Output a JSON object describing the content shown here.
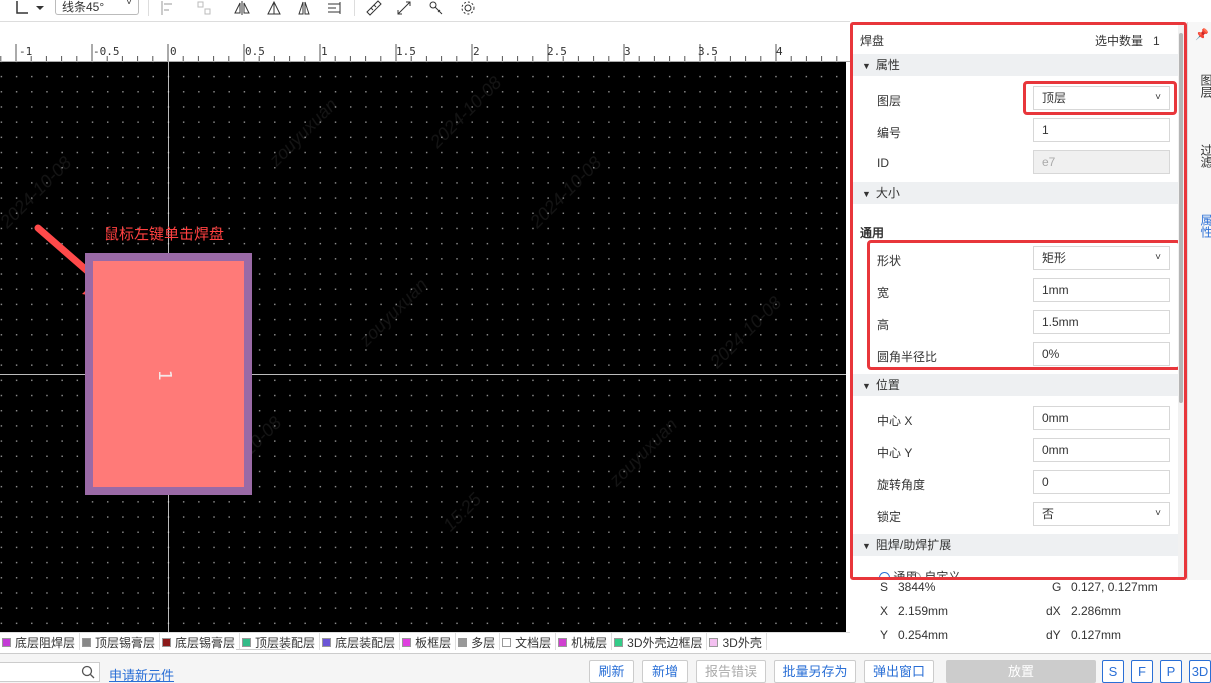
{
  "toolbar": {
    "line_mode": "线条45°"
  },
  "ruler": {
    "labels": [
      "-1",
      "-0.5",
      "0",
      "0.5",
      "1",
      "1.5",
      "2",
      "2.5",
      "3",
      "3.5",
      "4"
    ]
  },
  "canvas": {
    "annotation": "鼠标左键单击焊盘",
    "pad_number": "1",
    "watermarks": [
      "zouyuxuan",
      "2024-10-08",
      "15:25"
    ]
  },
  "layers": [
    {
      "name": "底层阻焊层",
      "color": "#c43bd6"
    },
    {
      "name": "顶层锡膏层",
      "color": "#888888"
    },
    {
      "name": "底层锡膏层",
      "color": "#8b1a1a"
    },
    {
      "name": "顶层装配层",
      "color": "#33bb88"
    },
    {
      "name": "底层装配层",
      "color": "#6b55d6"
    },
    {
      "name": "板框层",
      "color": "#e040e0"
    },
    {
      "name": "多层",
      "color": "#999999"
    },
    {
      "name": "文档层",
      "color": "#ffffff"
    },
    {
      "name": "机械层",
      "color": "#d040d0"
    },
    {
      "name": "3D外壳边框层",
      "color": "#33cc88"
    },
    {
      "name": "3D外壳",
      "color": "#f3c0f0"
    }
  ],
  "bottom": {
    "new_part_link": "申请新元件",
    "refresh": "刷新",
    "add": "新增",
    "report_error": "报告错误",
    "batch_save": "批量另存为",
    "popup": "弹出窗口",
    "place": "放置",
    "s": "S",
    "f": "F",
    "p": "P",
    "three_d": "3D"
  },
  "panel": {
    "title": "焊盘",
    "selected_count_label": "选中数量",
    "selected_count": "1",
    "sect_props": "属性",
    "layer_label": "图层",
    "layer_value": "顶层",
    "number_label": "编号",
    "number_value": "1",
    "id_label": "ID",
    "id_value": "e7",
    "sect_size": "大小",
    "general": "通用",
    "shape_label": "形状",
    "shape_value": "矩形",
    "width_label": "宽",
    "width_value": "1mm",
    "height_label": "高",
    "height_value": "1.5mm",
    "radius_label": "圆角半径比",
    "radius_value": "0%",
    "sect_pos": "位置",
    "cx_label": "中心 X",
    "cx_value": "0mm",
    "cy_label": "中心 Y",
    "cy_value": "0mm",
    "rot_label": "旋转角度",
    "rot_value": "0",
    "lock_label": "锁定",
    "lock_value": "否",
    "sect_mask": "阻焊/助焊扩展",
    "opt_general": "通用",
    "opt_custom": "自定义"
  },
  "sidetabs": [
    "图层",
    "过滤",
    "属性"
  ],
  "status": {
    "s_label": "S",
    "s_value": "3844%",
    "g_label": "G",
    "g_value": "0.127, 0.127mm",
    "x_label": "X",
    "x_value": "2.159mm",
    "dx_label": "dX",
    "dx_value": "2.286mm",
    "y_label": "Y",
    "y_value": "0.254mm",
    "dy_label": "dY",
    "dy_value": "0.127mm"
  },
  "colors": {
    "highlight": "#e8363b",
    "link": "#2a6fd6",
    "pad_fill": "#ff7a78",
    "pad_mask": "#9a6aa6"
  }
}
